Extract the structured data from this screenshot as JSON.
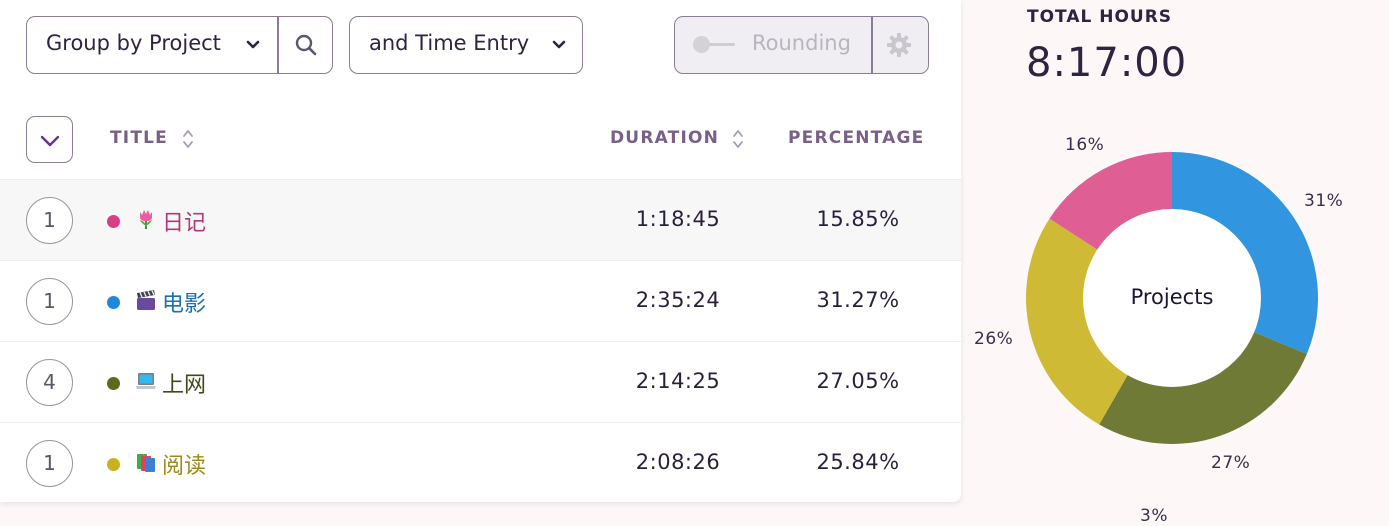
{
  "toolbar": {
    "group_by_label": "Group by Project",
    "secondary_label": "and Time Entry",
    "rounding_label": "Rounding"
  },
  "table": {
    "headers": {
      "title": "TITLE",
      "duration": "DURATION",
      "percentage": "PERCENTAGE"
    },
    "rows": [
      {
        "count": "1",
        "emoji": "tulip",
        "title": "日记",
        "color": "#d63f86",
        "duration": "1:18:45",
        "percentage": "15.85%"
      },
      {
        "count": "1",
        "emoji": "clapper-board",
        "title": "电影",
        "color": "#1f86d8",
        "duration": "2:35:24",
        "percentage": "31.27%"
      },
      {
        "count": "4",
        "emoji": "laptop",
        "title": "上网",
        "color": "#5c6a1c",
        "duration": "2:14:25",
        "percentage": "27.05%"
      },
      {
        "count": "1",
        "emoji": "books",
        "title": "阅读",
        "color": "#c9b21d",
        "duration": "2:08:26",
        "percentage": "25.84%"
      }
    ]
  },
  "summary": {
    "total_label": "TOTAL HOURS",
    "total_value": "8:17:00"
  },
  "chart_data": {
    "type": "pie",
    "center_label": "Projects",
    "slices": [
      {
        "label": "31%",
        "value": 31.27,
        "color": "#3196df"
      },
      {
        "label": "27%",
        "value": 27.05,
        "color": "#6e7a36"
      },
      {
        "label": "26%",
        "value": 25.84,
        "color": "#cfba36"
      },
      {
        "label": "16%",
        "value": 15.85,
        "color": "#df5e94"
      }
    ],
    "extra_labels": [
      "3%"
    ]
  }
}
